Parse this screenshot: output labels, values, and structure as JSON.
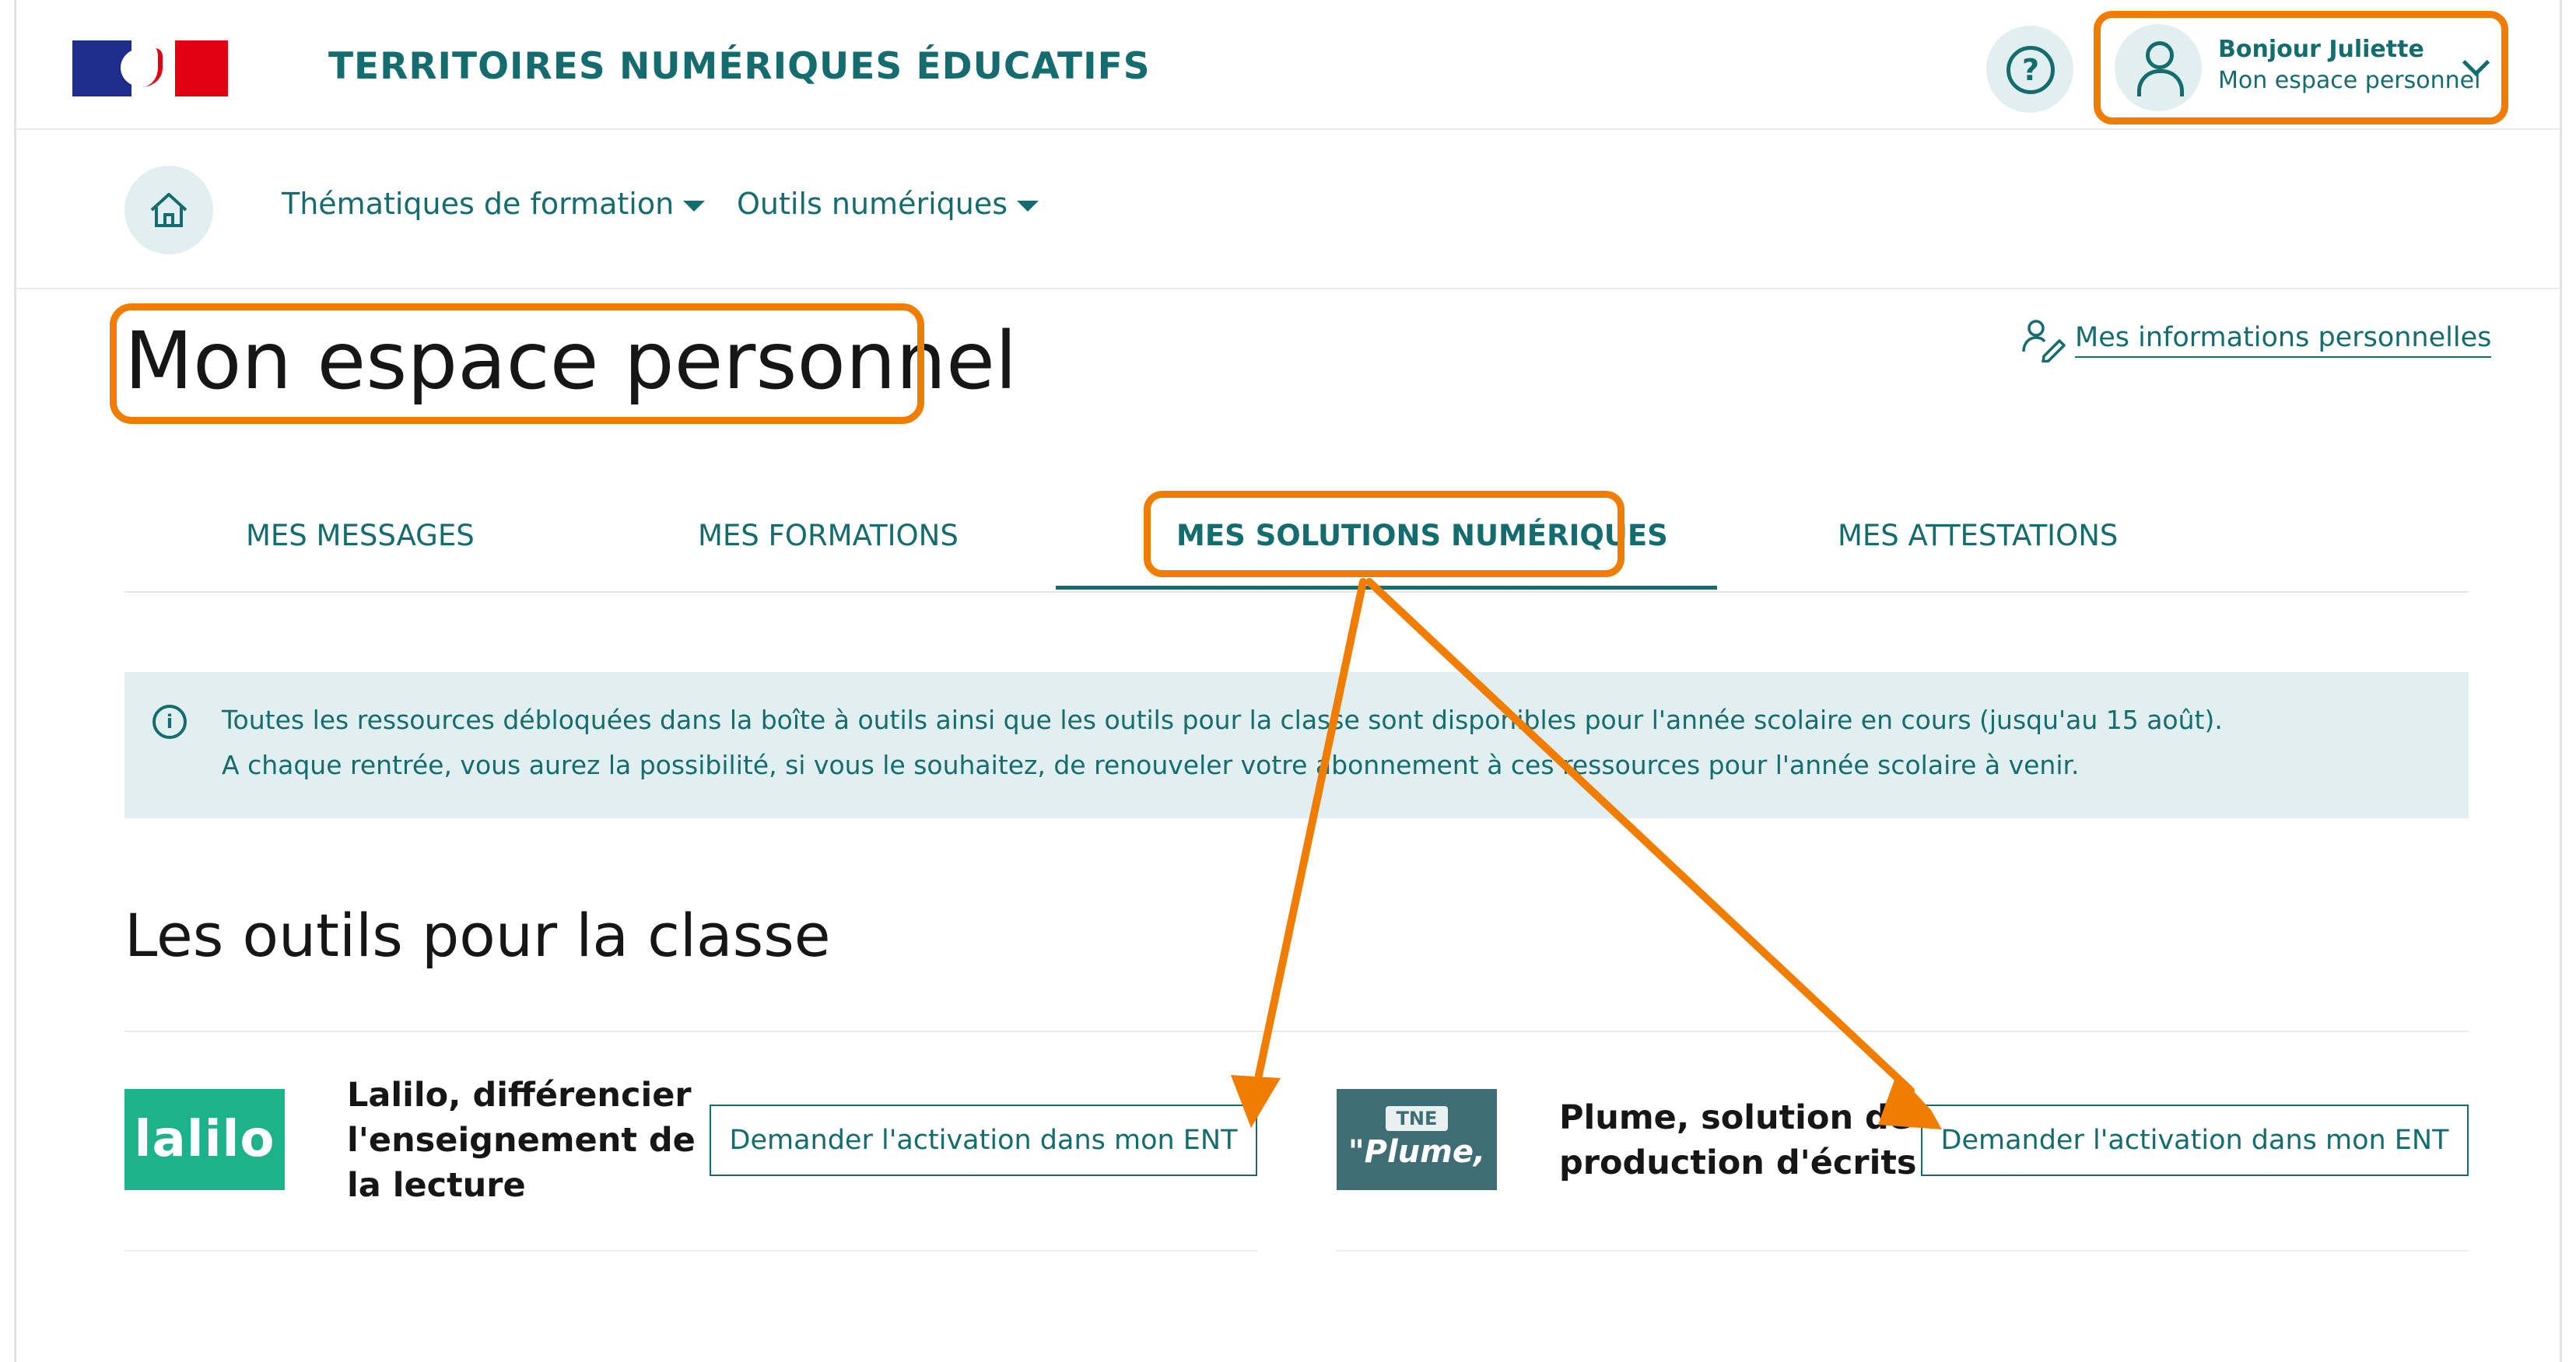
{
  "header": {
    "site_title": "TERRITOIRES NUMÉRIQUES ÉDUCATIFS",
    "help_label": "?",
    "account_greeting": "Bonjour Juliette",
    "account_subtitle": "Mon espace personnel"
  },
  "nav": {
    "items": [
      {
        "label": "Thématiques de formation"
      },
      {
        "label": "Outils numériques"
      }
    ]
  },
  "page": {
    "title": "Mon espace personnel",
    "personal_info_link": "Mes informations personnelles"
  },
  "tabs": [
    {
      "label": "MES MESSAGES"
    },
    {
      "label": "MES FORMATIONS"
    },
    {
      "label": "MES SOLUTIONS NUMÉRIQUES",
      "active": true
    },
    {
      "label": "MES ATTESTATIONS"
    }
  ],
  "info": {
    "line1": "Toutes les ressources débloquées dans la boîte à outils ainsi que les outils pour la classe sont disponibles pour l'année scolaire en cours (jusqu'au 15 août).",
    "line2": "A chaque rentrée, vous aurez la possibilité, si vous le souhaitez, de renouveler votre abonnement à ces ressources pour l'année scolaire à venir."
  },
  "section": {
    "title": "Les outils pour la classe"
  },
  "tools": [
    {
      "logo_text": "lalilo",
      "name_lines": [
        "Lalilo, différencier",
        "l'enseignement de",
        "la lecture"
      ],
      "button": "Demander l'activation dans mon ENT"
    },
    {
      "logo_badge": "TNE",
      "logo_text": "\"Plume,",
      "name_lines": [
        "Plume, solution de",
        "production d'écrits"
      ],
      "button": "Demander l'activation dans mon ENT"
    }
  ],
  "colors": {
    "accent_teal": "#146c6f",
    "annotation_orange": "#f07d00",
    "banner_bg": "#e2eff0",
    "lalilo_green": "#1db38a",
    "plume_slate": "#3f6d75"
  },
  "icons": {
    "home": "home-icon",
    "help": "question-circle-icon",
    "user": "user-icon",
    "info": "info-circle-icon",
    "personal_info": "user-edit-icon"
  }
}
